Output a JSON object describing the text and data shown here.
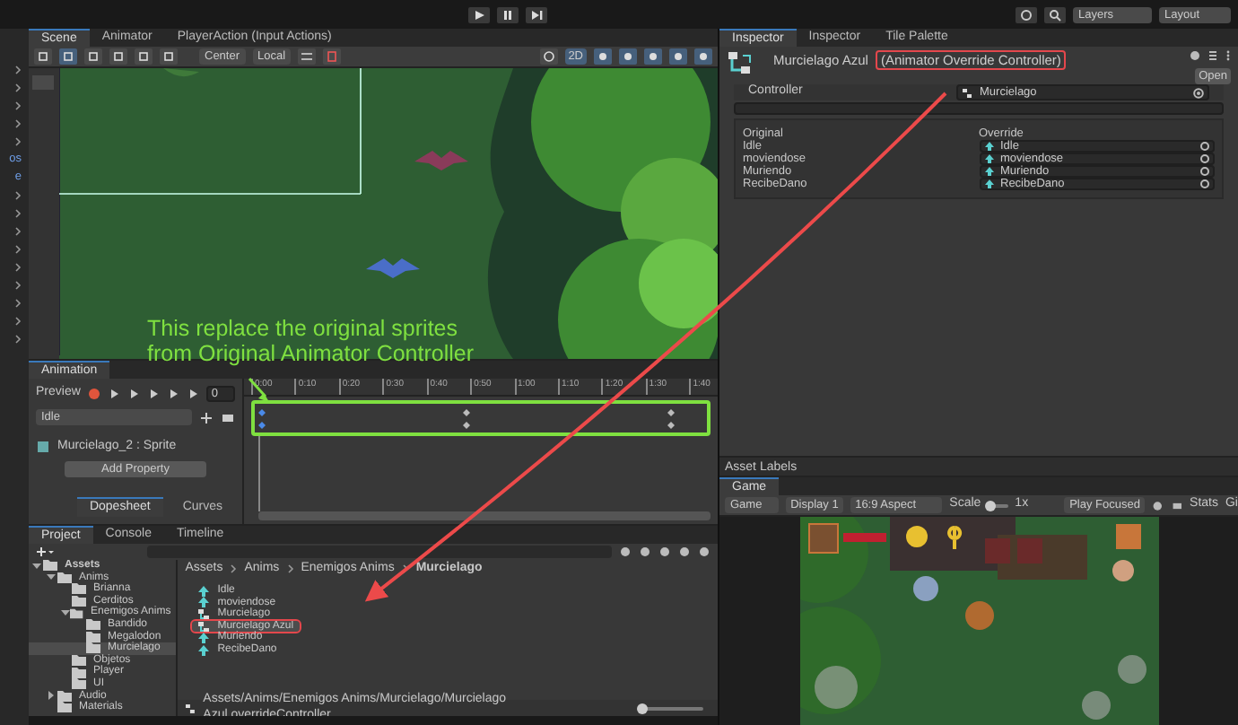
{
  "top_bar": {
    "layers": "Layers",
    "layout": "Layout"
  },
  "hierarchy_fragments": [
    "os",
    "e"
  ],
  "scene_panel": {
    "tabs": [
      {
        "label": "Scene",
        "selected": true
      },
      {
        "label": "Animator",
        "selected": false
      },
      {
        "label": "PlayerAction (Input Actions)",
        "selected": false
      }
    ],
    "pivot": "Center",
    "space": "Local",
    "mode_2d": "2D"
  },
  "annotation": {
    "lines": [
      "This replace the original sprites",
      "from Original Animator Controller"
    ]
  },
  "animation_panel": {
    "tab": "Animation",
    "preview": "Preview",
    "frame": "0",
    "clip": "Idle",
    "property": "Murcielago_2 : Sprite",
    "add_property": "Add Property",
    "ticks": [
      "0:00",
      "0:10",
      "0:20",
      "0:30",
      "0:40",
      "0:50",
      "1:00",
      "1:10",
      "1:20",
      "1:30",
      "1:40"
    ],
    "keyframes_highlighted": true,
    "views": [
      {
        "label": "Dopesheet",
        "selected": true
      },
      {
        "label": "Curves",
        "selected": false
      }
    ]
  },
  "project_panel": {
    "tabs": [
      {
        "label": "Project",
        "selected": true
      },
      {
        "label": "Console",
        "selected": false
      },
      {
        "label": "Timeline",
        "selected": false
      }
    ],
    "tree": [
      {
        "label": "Assets",
        "expanded": true,
        "selected": false,
        "children": [
          {
            "label": "Anims",
            "expanded": true,
            "selected": false,
            "children": [
              {
                "label": "Brianna",
                "selected": false
              },
              {
                "label": "Cerditos",
                "selected": false
              },
              {
                "label": "Enemigos Anims",
                "expanded": true,
                "selected": false,
                "children": [
                  {
                    "label": "Bandido",
                    "selected": false
                  },
                  {
                    "label": "Megalodon",
                    "selected": false
                  },
                  {
                    "label": "Murcielago",
                    "selected": true
                  }
                ]
              },
              {
                "label": "Objetos",
                "selected": false
              },
              {
                "label": "Player",
                "selected": false
              },
              {
                "label": "UI",
                "selected": false
              }
            ]
          },
          {
            "label": "Audio",
            "expanded": false,
            "selected": false
          },
          {
            "label": "Materials",
            "selected": false
          }
        ]
      }
    ],
    "breadcrumb": [
      "Assets",
      "Anims",
      "Enemigos Anims",
      "Murcielago"
    ],
    "files": [
      {
        "label": "Idle",
        "kind": "anim",
        "selected": false,
        "highlighted": false
      },
      {
        "label": "moviendose",
        "kind": "anim",
        "selected": false,
        "highlighted": false
      },
      {
        "label": "Murcielago",
        "kind": "controller",
        "selected": false,
        "highlighted": false
      },
      {
        "label": "Murcielago Azul",
        "kind": "controller",
        "selected": true,
        "highlighted": true
      },
      {
        "label": "Muriendo",
        "kind": "anim",
        "selected": false,
        "highlighted": false
      },
      {
        "label": "RecibeDano",
        "kind": "anim",
        "selected": false,
        "highlighted": false
      }
    ],
    "path": "Assets/Anims/Enemigos Anims/Murcielago/Murcielago Azul.overrideController",
    "zoom_slider": {
      "level": 0.05
    }
  },
  "inspector": {
    "tabs": [
      {
        "label": "Inspector",
        "selected": true
      },
      {
        "label": "Inspector",
        "selected": false
      },
      {
        "label": "Tile Palette",
        "selected": false
      }
    ],
    "asset_name": "Murcielago Azul",
    "asset_type": "(Animator Override Controller)",
    "type_highlighted": true,
    "open_button": "Open",
    "controller_label": "Controller",
    "controller_value": "Murcielago",
    "columns": [
      "Original",
      "Override"
    ],
    "rows": [
      {
        "original": "Idle",
        "override": "Idle"
      },
      {
        "original": "moviendose",
        "override": "moviendose"
      },
      {
        "original": "Muriendo",
        "override": "Muriendo"
      },
      {
        "original": "RecibeDano",
        "override": "RecibeDano"
      }
    ]
  },
  "asset_labels": "Asset Labels",
  "game_panel": {
    "tab": "Game",
    "view": "Game",
    "display": "Display 1",
    "aspect": "16:9 Aspect",
    "scale_label": "Scale",
    "scale": "1x",
    "scale_slider": {
      "level": 0.1
    },
    "play_mode": "Play Focused",
    "stats": "Stats",
    "gizmos": "Gi"
  }
}
